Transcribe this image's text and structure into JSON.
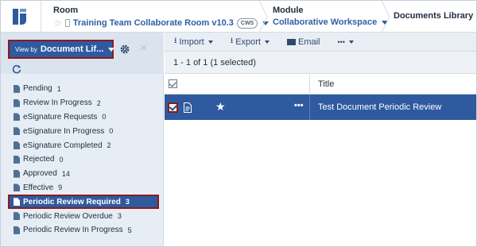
{
  "header": {
    "room_label": "Room",
    "room_name": "Training Team Collaborate Room v10.3",
    "room_badge": "CWS",
    "module_label": "Module",
    "module_name": "Collaborative Workspace",
    "page_title": "Documents Library"
  },
  "sidebar": {
    "view_by_small": "View by",
    "view_by_value": "Document Lif...",
    "folders": [
      {
        "label": "Pending",
        "count": "1"
      },
      {
        "label": "Review In Progress",
        "count": "2"
      },
      {
        "label": "eSignature Requests",
        "count": "0"
      },
      {
        "label": "eSignature In Progress",
        "count": "0"
      },
      {
        "label": "eSignature Completed",
        "count": "2"
      },
      {
        "label": "Rejected",
        "count": "0"
      },
      {
        "label": "Approved",
        "count": "14"
      },
      {
        "label": "Effective",
        "count": "9"
      },
      {
        "label": "Periodic Review Required",
        "count": "3",
        "selected": true
      },
      {
        "label": "Periodic Review Overdue",
        "count": "3"
      },
      {
        "label": "Periodic Review In Progress",
        "count": "5"
      }
    ]
  },
  "toolbar": {
    "import_label": "Import",
    "export_label": "Export",
    "email_label": "Email",
    "more_label": "•••"
  },
  "list": {
    "summary": "1 - 1 of 1 (1 selected)",
    "title_header": "Title",
    "rows": [
      {
        "more": "•••",
        "title": "Test Document Periodic Review"
      }
    ]
  },
  "colors": {
    "brand_blue": "#2f5aa0",
    "link_blue": "#2f5fa6",
    "highlight_red": "#8b1b1b",
    "sidebar_bg": "#e6edf4"
  }
}
